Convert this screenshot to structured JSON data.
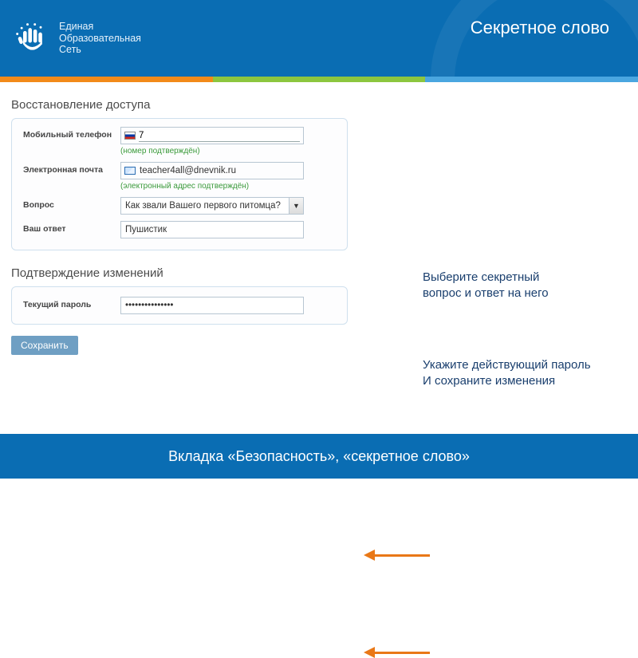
{
  "header": {
    "brand_line1": "Единая",
    "brand_line2": "Образовательная",
    "brand_line3": "Сеть",
    "title": "Секретное слово"
  },
  "sections": {
    "access": {
      "title": "Восстановление доступа",
      "phone": {
        "label": "Мобильный телефон",
        "value": "7",
        "hint": "(номер подтверждён)"
      },
      "email": {
        "label": "Электронная почта",
        "value": "teacher4all@dnevnik.ru",
        "hint": "(электронный адрес подтверждён)"
      },
      "question": {
        "label": "Вопрос",
        "value": "Как звали Вашего первого питомца?"
      },
      "answer": {
        "label": "Ваш ответ",
        "value": "Пушистик"
      }
    },
    "confirm": {
      "title": "Подтверждение изменений",
      "password": {
        "label": "Текущий пароль",
        "value": "•••••••••••••••"
      }
    },
    "save_label": "Сохранить"
  },
  "callouts": {
    "c1_line1": "Выберите секретный",
    "c1_line2": "вопрос и ответ на него",
    "c2_line1": "Укажите действующий пароль",
    "c2_line2": "И сохраните изменения"
  },
  "footer": {
    "text": "Вкладка «Безопасность», «секретное слово»"
  }
}
